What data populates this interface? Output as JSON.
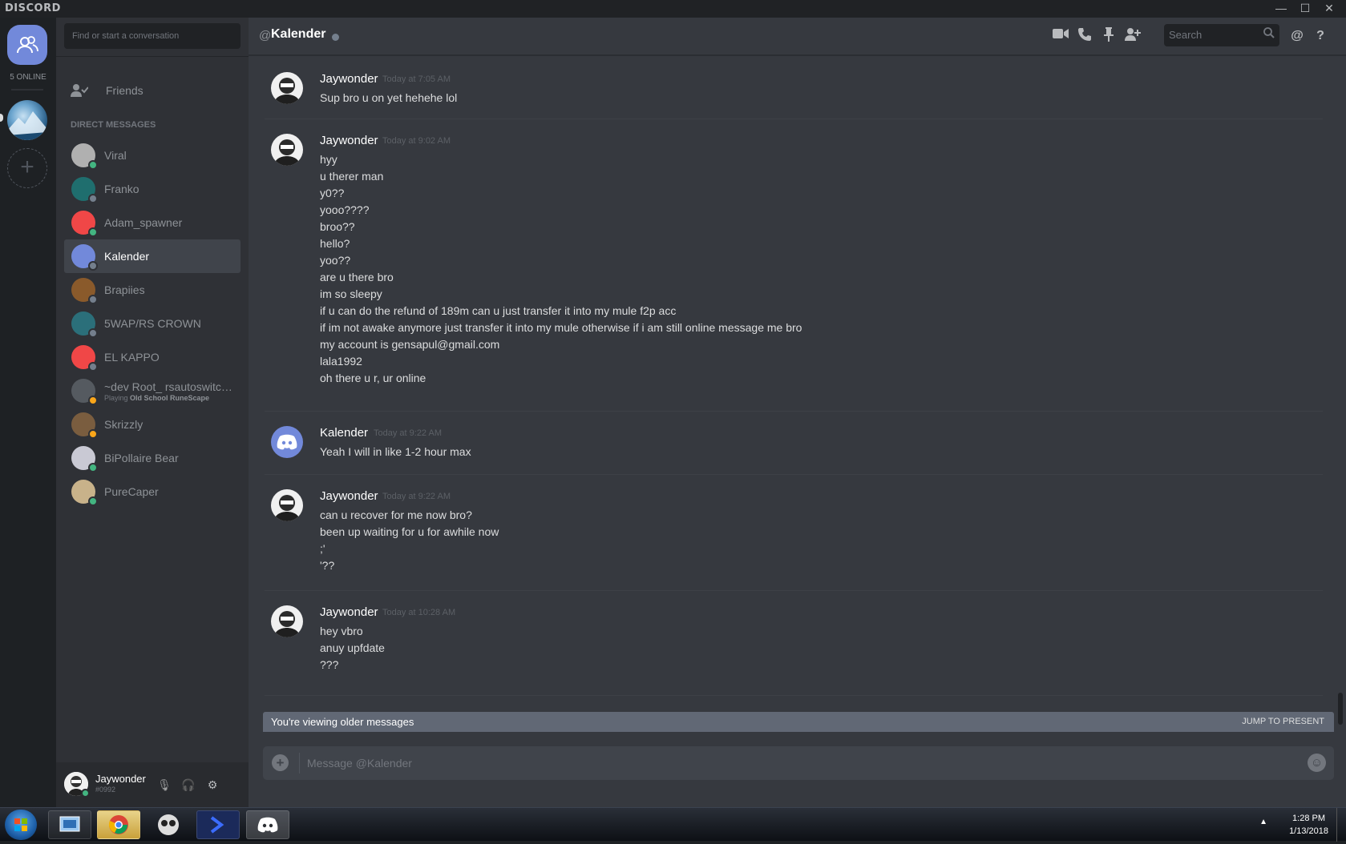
{
  "window": {
    "brand": "DISCORD",
    "minimize": "—",
    "maximize": "☐",
    "close": "✕"
  },
  "guilds": {
    "online_count": "5 ONLINE",
    "add_label": "+"
  },
  "sidebar": {
    "search_placeholder": "Find or start a conversation",
    "friends_label": "Friends",
    "dm_header": "Direct Messages",
    "dms": [
      {
        "name": "Viral",
        "color": "#b0b0b0",
        "status": "#43b581"
      },
      {
        "name": "Franko",
        "color": "#1f6e6e",
        "status": "#747f8d"
      },
      {
        "name": "Adam_spawner",
        "color": "#f04747",
        "status": "#43b581"
      },
      {
        "name": "Kalender",
        "color": "#7289da",
        "status": "#747f8d"
      },
      {
        "name": "Brapiies",
        "color": "#8a5a2b",
        "status": "#747f8d"
      },
      {
        "name": "5WAP/RS CROWN",
        "color": "#2b6f7a",
        "status": "#747f8d"
      },
      {
        "name": "EL KAPPO",
        "color": "#f04747",
        "status": "#747f8d"
      },
      {
        "name": "~dev Root_ rsautoswitch...",
        "color": "#555a60",
        "status": "#faa61a",
        "sub_prefix": "Playing ",
        "sub_game": "Old School RuneScape"
      },
      {
        "name": "Skrizzly",
        "color": "#7a5d3f",
        "status": "#faa61a"
      },
      {
        "name": "BiPollaire Bear",
        "color": "#c9c9d4",
        "status": "#43b581"
      },
      {
        "name": "PureCaper",
        "color": "#c8b28a",
        "status": "#43b581"
      }
    ]
  },
  "user_panel": {
    "name": "Jaywonder",
    "tag": "#0992",
    "mic": "🎙",
    "headset": "🎧",
    "settings": "⚙"
  },
  "chat": {
    "at_symbol": "@",
    "title": "Kalender",
    "search_placeholder": "Search",
    "messages": [
      {
        "author": "Jaywonder",
        "time": "Today at 7:05 AM",
        "lines": [
          "Sup bro u on yet hehehe lol"
        ]
      },
      {
        "author": "Jaywonder",
        "time": "Today at 9:02 AM",
        "lines": [
          "hyy",
          "u therer man",
          "y0??",
          "yooo????",
          "broo??",
          "hello?",
          "yoo??",
          "are u there bro",
          "im so sleepy",
          "if u can do the refund of 189m can u just transfer it into my mule f2p acc",
          "if im not awake anymore just transfer it into my mule otherwise if i am still online message me bro",
          "my account is gensapul@gmail.com",
          "lala1992",
          "oh there u r, ur online"
        ]
      },
      {
        "author": "Kalender",
        "time": "Today at 9:22 AM",
        "lines": [
          "Yeah I will in like 1-2 hour max"
        ]
      },
      {
        "author": "Jaywonder",
        "time": "Today at 9:22 AM",
        "lines": [
          "can u recover for me now bro?",
          "been up waiting for u for awhile now",
          ";'",
          "'??"
        ]
      },
      {
        "author": "Jaywonder",
        "time": "Today at 10:28 AM",
        "lines": [
          "hey vbro",
          "anuy upfdate",
          "???"
        ]
      }
    ],
    "older_notice": "You're viewing older messages",
    "jump_label": "Jump to present",
    "composer_placeholder": "Message @Kalender"
  },
  "taskbar": {
    "time": "1:28 PM",
    "date": "1/13/2018",
    "tray_arrow": "▲"
  }
}
